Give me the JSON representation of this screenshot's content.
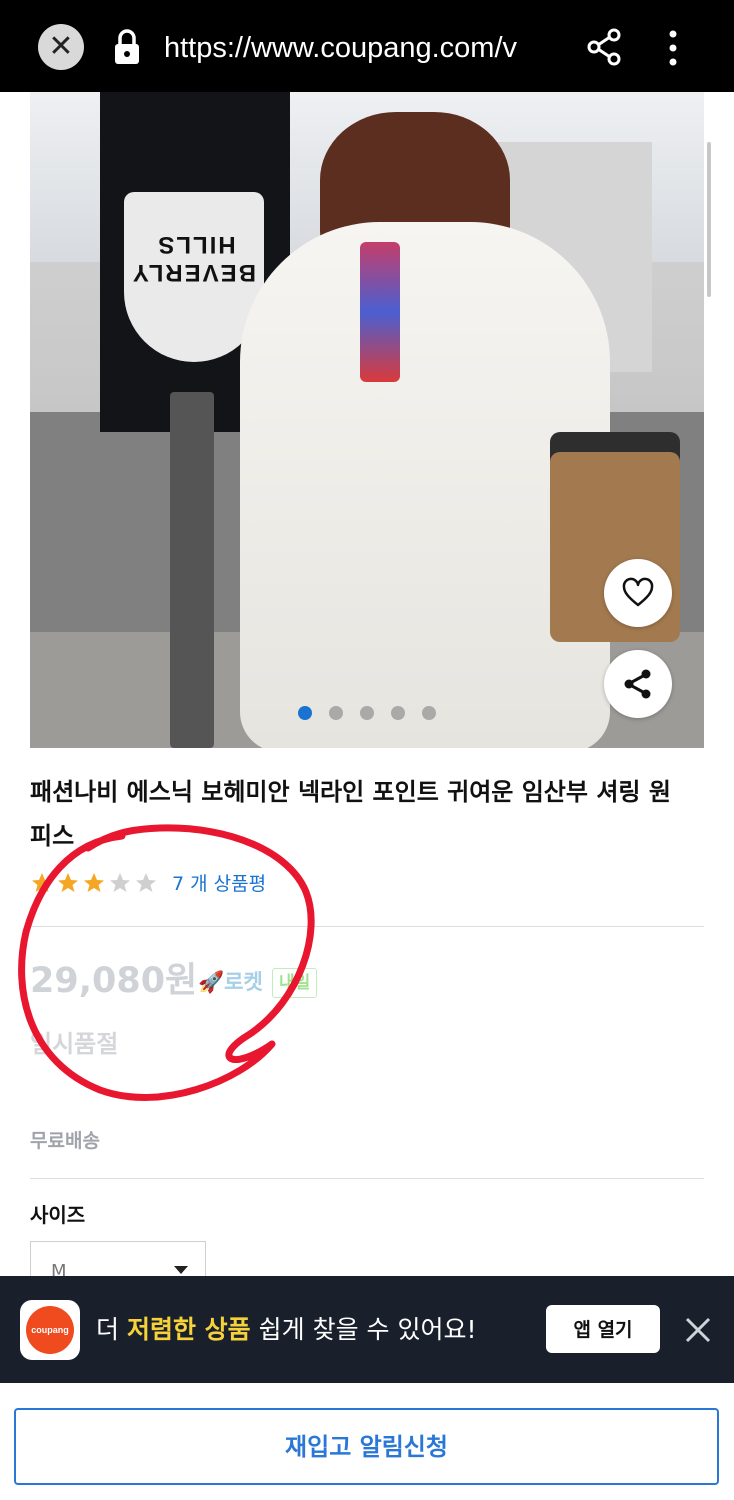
{
  "browser": {
    "url": "https://www.coupang.com/v",
    "close_icon": "close-icon",
    "lock_icon": "lock-icon",
    "share_icon": "share-icon",
    "menu_icon": "more-vertical-icon"
  },
  "gallery": {
    "active_index": 0,
    "dot_count": 5,
    "wishlist_icon": "heart-icon",
    "share_icon": "share-icon",
    "print_text": "BEVERLY HILLS"
  },
  "product": {
    "title": "패션나비 에스닉 보헤미안 넥라인 포인트 귀여운 임산부 셔링 원피스",
    "rating": 3,
    "rating_max": 5,
    "review_count_label": "7 개 상품평",
    "price": "29,080원",
    "rocket_label": "로켓",
    "rocket_day": "내일",
    "stock_status": "일시품절",
    "shipping": "무료배송",
    "size_label": "사이즈",
    "size_value": "M"
  },
  "app_banner": {
    "logo_text": "coupang",
    "text_prefix": "더 ",
    "text_highlight": "저렴한 상품",
    "text_suffix": " 쉽게 찾을 수 있어요!",
    "open_button": "앱 열기",
    "close_icon": "close-icon"
  },
  "restock_button": "재입고 알림신청",
  "colors": {
    "accent": "#2a78d6",
    "annotation": "#e8162f",
    "banner_bg": "#19202c",
    "highlight": "#f5d13a"
  }
}
